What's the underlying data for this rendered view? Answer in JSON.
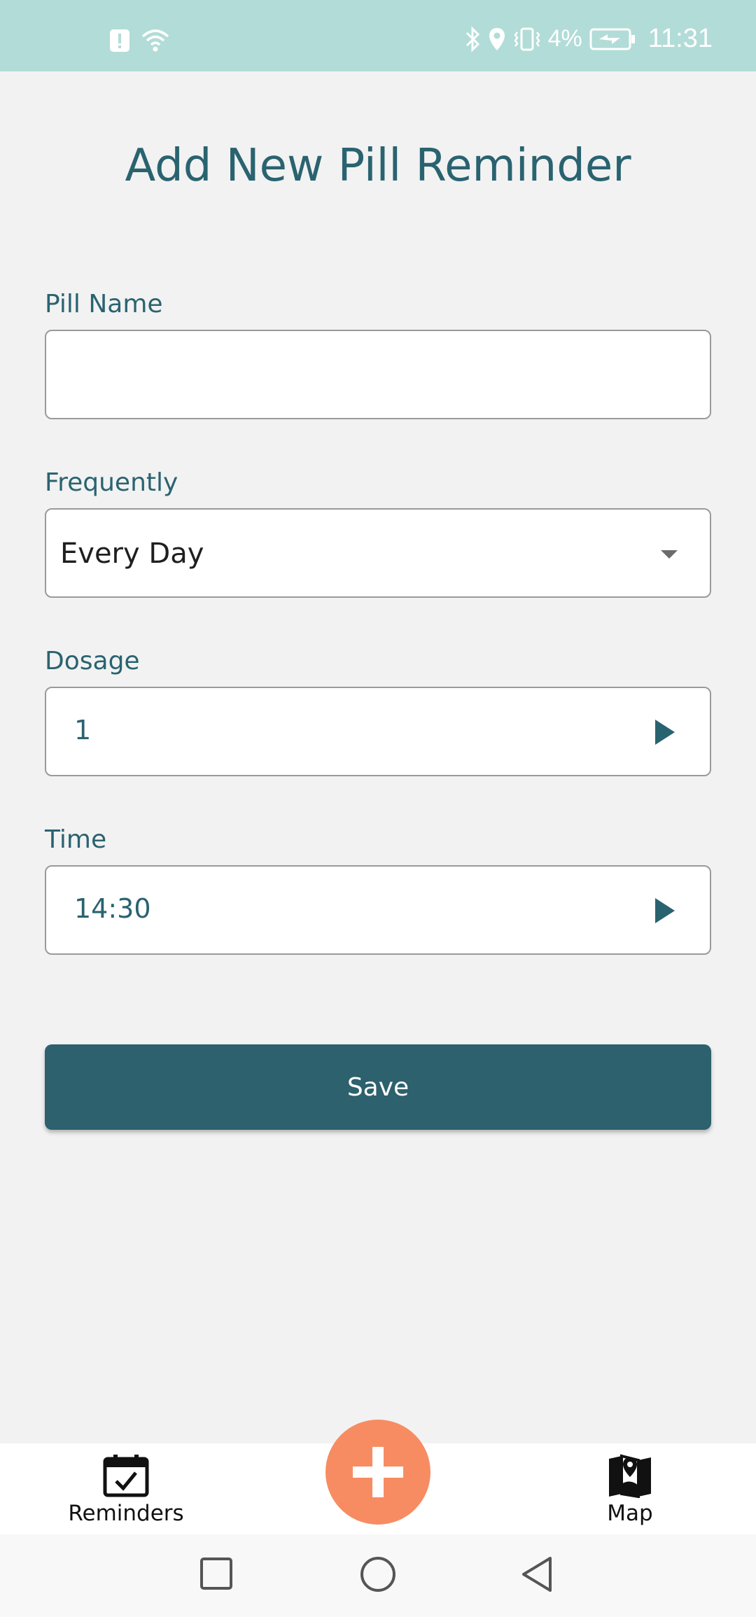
{
  "status_bar": {
    "battery_percent": "4%",
    "time": "11:31",
    "background_color": "#b2dcd7",
    "icons": [
      "alert-icon",
      "wifi-icon",
      "bluetooth-icon",
      "location-icon",
      "vibrate-icon",
      "battery-charging-icon"
    ]
  },
  "page": {
    "title": "Add New Pill Reminder",
    "accent_color": "#2a6370"
  },
  "form": {
    "pill_name": {
      "label": "Pill Name",
      "value": ""
    },
    "frequency": {
      "label": "Frequently",
      "value": "Every Day"
    },
    "dosage": {
      "label": "Dosage",
      "value": "1"
    },
    "time": {
      "label": "Time",
      "value": "14:30"
    },
    "save_label": "Save",
    "save_color": "#2c616d"
  },
  "bottom_nav": {
    "items": [
      {
        "label": "Reminders",
        "icon": "calendar-check-icon"
      },
      {
        "label": "Map",
        "icon": "map-pin-icon"
      }
    ],
    "fab_icon": "plus-icon",
    "fab_color": "#f78c62"
  },
  "system_nav": {
    "icons": [
      "recent-apps-icon",
      "home-icon",
      "back-icon"
    ]
  }
}
